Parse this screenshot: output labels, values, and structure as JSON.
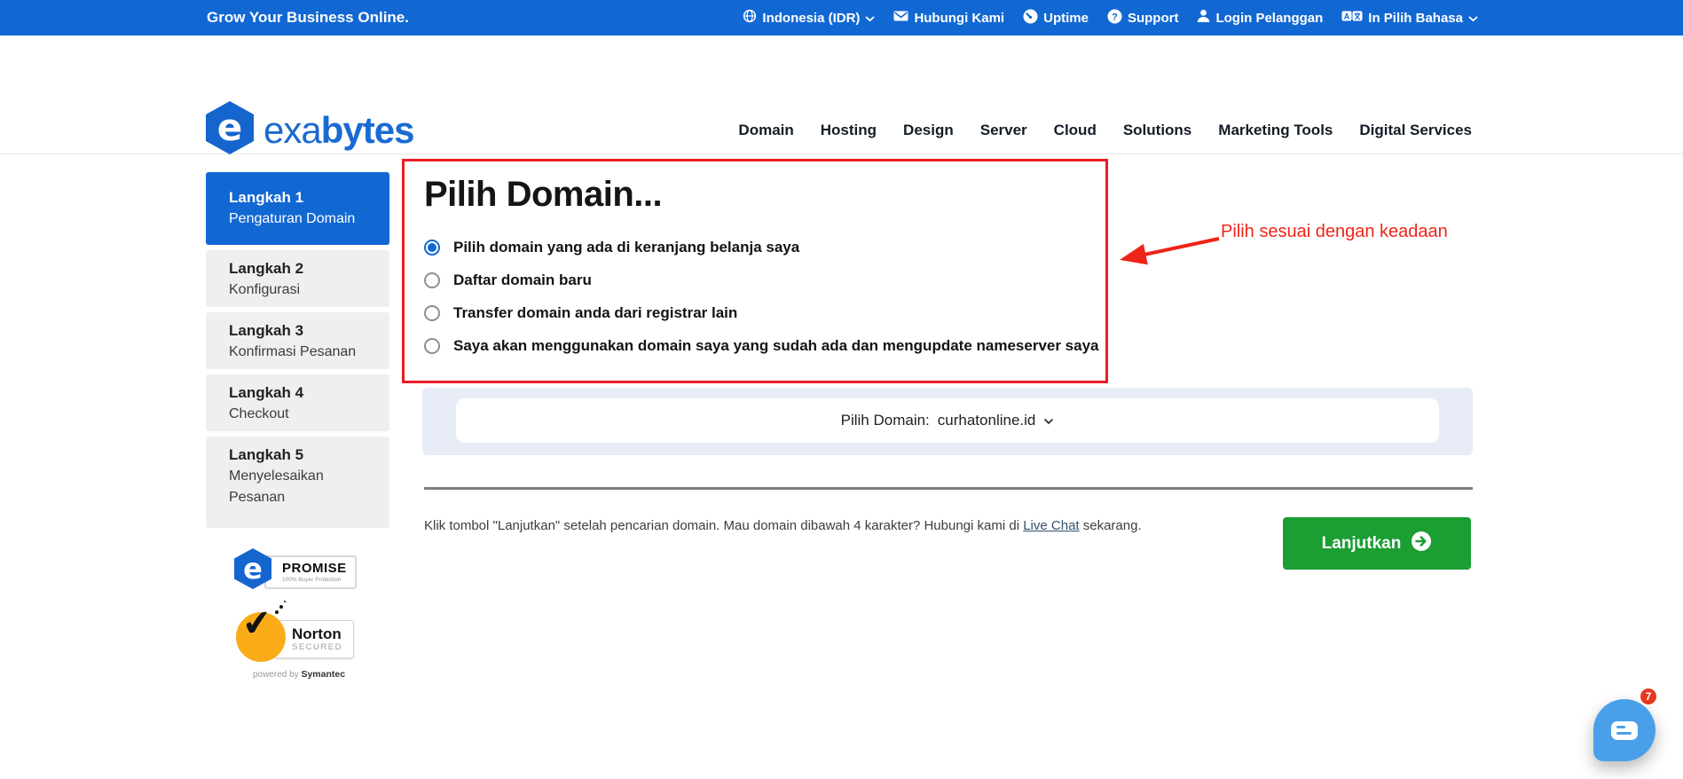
{
  "topbar": {
    "brand": "Grow Your Business Online.",
    "items": [
      {
        "icon": "globe-icon",
        "label": "Indonesia (IDR)",
        "chevron": true
      },
      {
        "icon": "mail-icon",
        "label": "Hubungi Kami",
        "chevron": false
      },
      {
        "icon": "uptime-gauge-icon",
        "label": "Uptime",
        "chevron": false
      },
      {
        "icon": "support-question-icon",
        "label": "Support",
        "chevron": false
      },
      {
        "icon": "user-icon",
        "label": "Login Pelanggan",
        "chevron": false
      },
      {
        "icon": "translate-icon",
        "label": "In Pilih Bahasa",
        "chevron": true
      }
    ]
  },
  "header": {
    "logo": {
      "mark": "e",
      "text_light": "exa",
      "text_bold": "bytes"
    },
    "nav": [
      {
        "label": "Domain"
      },
      {
        "label": "Hosting"
      },
      {
        "label": "Design"
      },
      {
        "label": "Server"
      },
      {
        "label": "Cloud"
      },
      {
        "label": "Solutions"
      },
      {
        "label": "Marketing Tools"
      },
      {
        "label": "Digital Services"
      }
    ]
  },
  "sidebar": {
    "steps": [
      {
        "title": "Langkah 1",
        "subtitle": "Pengaturan Domain",
        "active": true
      },
      {
        "title": "Langkah 2",
        "subtitle": "Konfigurasi",
        "active": false
      },
      {
        "title": "Langkah 3",
        "subtitle": "Konfirmasi Pesanan",
        "active": false
      },
      {
        "title": "Langkah 4",
        "subtitle": "Checkout",
        "active": false
      },
      {
        "title": "Langkah 5",
        "subtitle": "Menyelesaikan Pesanan",
        "active": false
      }
    ],
    "badges": {
      "promise": {
        "mark": "e",
        "label": "PROMISE",
        "sub": "100% Buyer Protection"
      },
      "norton": {
        "check": "✔",
        "label": "Norton",
        "sub": "SECURED",
        "powered": "powered by",
        "powered_brand": "Symantec"
      }
    }
  },
  "main": {
    "heading": "Pilih Domain...",
    "options": [
      {
        "label": "Pilih domain yang ada di keranjang belanja saya",
        "selected": true
      },
      {
        "label": "Daftar domain baru",
        "selected": false
      },
      {
        "label": "Transfer domain anda dari registrar lain",
        "selected": false
      },
      {
        "label": "Saya akan menggunakan domain saya yang sudah ada dan mengupdate nameserver saya",
        "selected": false
      }
    ],
    "domain_picker": {
      "label": "Pilih Domain:",
      "value": "curhatonline.id"
    },
    "hint": {
      "before": "Klik tombol \"Lanjutkan\" setelah pencarian domain. Mau domain dibawah 4 karakter? Hubungi kami di ",
      "link": "Live Chat",
      "after": " sekarang."
    },
    "continue_label": "Lanjutkan"
  },
  "annotation": {
    "text": "Pilih sesuai dengan keadaan"
  },
  "chat": {
    "badge_count": "7"
  },
  "colors": {
    "topbar_blue": "#1268d3",
    "logo_blue": "#1a6ad1",
    "active_step_blue": "#1268d3",
    "annotation_red": "#ef2418",
    "box_red": "#ec1c24",
    "panel_lavender": "#e7ecf7",
    "button_green": "#1b9e32",
    "norton_yellow": "#f9ac17",
    "chat_blue": "#4aa0e8",
    "chat_badge_red": "#e63a1f"
  }
}
